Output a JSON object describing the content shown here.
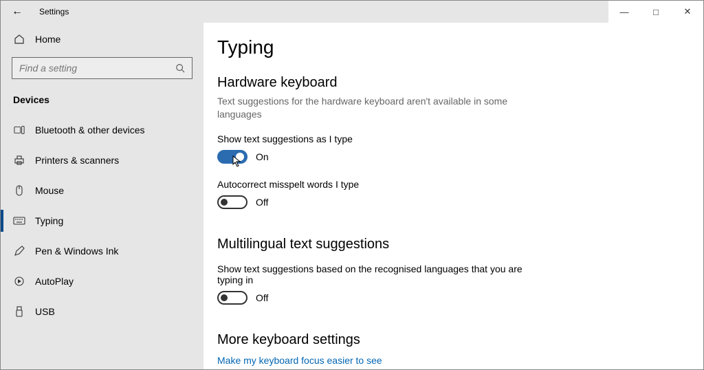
{
  "window": {
    "title": "Settings"
  },
  "sidebar": {
    "home_label": "Home",
    "search_placeholder": "Find a setting",
    "category": "Devices",
    "items": [
      {
        "label": "Bluetooth & other devices"
      },
      {
        "label": "Printers & scanners"
      },
      {
        "label": "Mouse"
      },
      {
        "label": "Typing"
      },
      {
        "label": "Pen & Windows Ink"
      },
      {
        "label": "AutoPlay"
      },
      {
        "label": "USB"
      }
    ]
  },
  "page": {
    "title": "Typing",
    "sections": {
      "hardware": {
        "title": "Hardware keyboard",
        "desc": "Text suggestions for the hardware keyboard aren't available in some languages",
        "suggestions_label": "Show text suggestions as I type",
        "suggestions_state": "On",
        "autocorrect_label": "Autocorrect misspelt words I type",
        "autocorrect_state": "Off"
      },
      "multilingual": {
        "title": "Multilingual text suggestions",
        "desc": "Show text suggestions based on the recognised languages that you are typing in",
        "state": "Off"
      },
      "more": {
        "title": "More keyboard settings",
        "link": "Make my keyboard focus easier to see"
      }
    }
  }
}
